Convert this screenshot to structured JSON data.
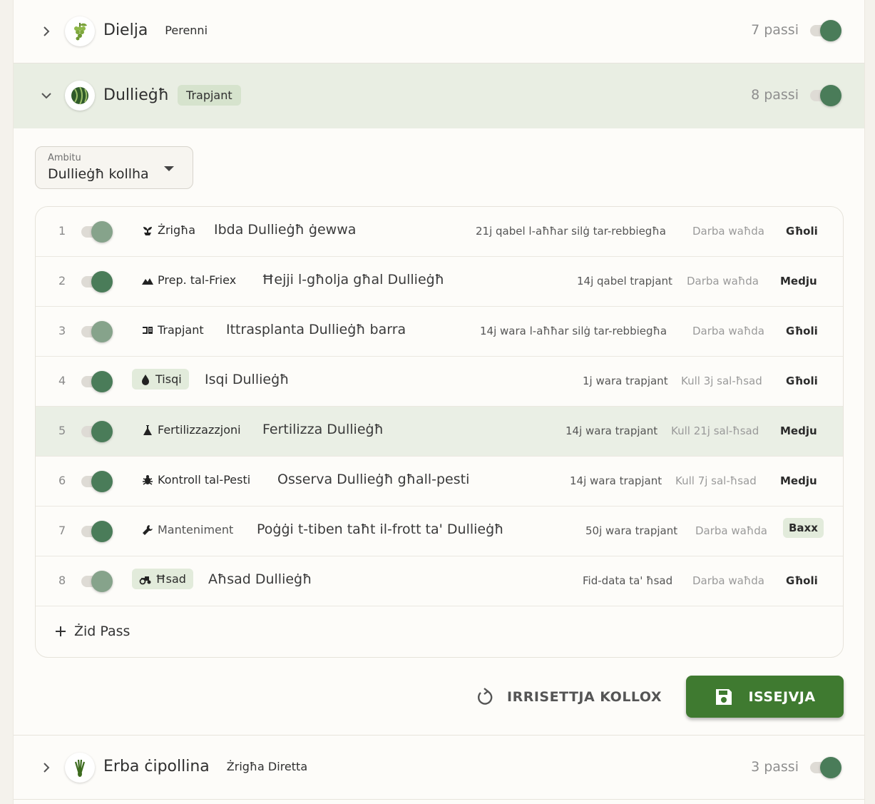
{
  "crops": [
    {
      "name": "Dielja",
      "tag": "Perenni",
      "steps_label": "7 passi",
      "enabled": true,
      "icon": "grapes-icon"
    },
    {
      "name": "Dullieġħ",
      "tag": "Trapjant",
      "steps_label": "8 passi",
      "enabled": true,
      "icon": "watermelon-icon"
    },
    {
      "name": "Erba ċipollina",
      "tag": "Żrigħa Diretta",
      "steps_label": "3 passi",
      "enabled": true,
      "icon": "chives-icon"
    }
  ],
  "scope": {
    "label": "Ambitu",
    "value": "Dullieġħ kollha"
  },
  "steps": [
    {
      "num": "1",
      "type": "Żrigħa",
      "type_icon": "sprout-icon",
      "title": "Ibda Dullieġħ ġewwa",
      "when": "21j qabel l-aħħar silġ tar-rebbiegħa",
      "freq": "Darba waħda",
      "difficulty": "Għoli",
      "enabled": true
    },
    {
      "num": "2",
      "type": "Prep. tal-Friex",
      "type_icon": "terrain-icon",
      "title": "Ħejji l-għolja għal Dullieġħ",
      "when": "14j qabel trapjant",
      "freq": "Darba waħda",
      "difficulty": "Medju",
      "enabled": true
    },
    {
      "num": "3",
      "type": "Trapjant",
      "type_icon": "transplant-icon",
      "title": "Ittrasplanta Dullieġħ barra",
      "when": "14j wara l-aħħar silġ tar-rebbiegħa",
      "freq": "Darba waħda",
      "difficulty": "Għoli",
      "enabled": true
    },
    {
      "num": "4",
      "type": "Tisqi",
      "type_icon": "water-drop-icon",
      "title": "Isqi Dullieġħ",
      "when": "1j wara trapjant",
      "freq": "Kull 3j sal-ħsad",
      "difficulty": "Għoli",
      "enabled": true
    },
    {
      "num": "5",
      "type": "Fertilizzazzjoni",
      "type_icon": "flask-icon",
      "title": "Fertilizza Dullieġħ",
      "when": "14j wara trapjant",
      "freq": "Kull 21j sal-ħsad",
      "difficulty": "Medju",
      "enabled": true
    },
    {
      "num": "6",
      "type": "Kontroll tal-Pesti",
      "type_icon": "bug-icon",
      "title": "Osserva Dullieġħ għall-pesti",
      "when": "14j wara trapjant",
      "freq": "Kull 7j sal-ħsad",
      "difficulty": "Medju",
      "enabled": true
    },
    {
      "num": "7",
      "type": "Manteniment",
      "type_icon": "wrench-icon",
      "title": "Poġġi t-tiben taħt il-frott ta' Dullieġħ",
      "when": "50j wara trapjant",
      "freq": "Darba waħda",
      "difficulty": "Baxx",
      "enabled": true
    },
    {
      "num": "8",
      "type": "Ħsad",
      "type_icon": "tractor-icon",
      "title": "Aħsad Dullieġħ",
      "when": "Fid-data ta' ħsad",
      "freq": "Darba waħda",
      "difficulty": "Għoli",
      "enabled": true
    }
  ],
  "add_step_label": "Żid Pass",
  "actions": {
    "reset_label": "IRRISETTJA KOLLOX",
    "save_label": "ISSEJVJA"
  },
  "colors": {
    "accent": "#4a7c59",
    "save_button": "#3f7a30",
    "expanded_bg": "#e9eee3",
    "pill_bg": "#d6e3cd"
  }
}
